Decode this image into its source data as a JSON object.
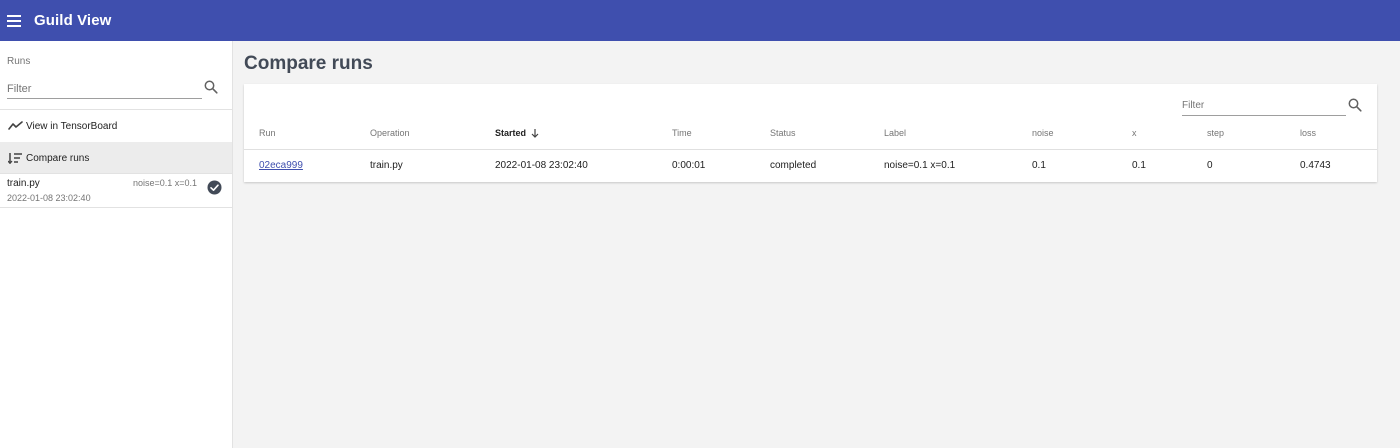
{
  "app": {
    "title": "Guild View"
  },
  "sidebar": {
    "section_title": "Runs",
    "filter_placeholder": "Filter",
    "actions": [
      {
        "label": "View in TensorBoard",
        "icon": "timeline-icon"
      },
      {
        "label": "Compare runs",
        "icon": "sort-list-icon"
      }
    ],
    "runs": [
      {
        "name": "train.py",
        "flags": "noise=0.1  x=0.1",
        "started": "2022-01-08 23:02:40",
        "status": "completed"
      }
    ]
  },
  "main": {
    "title": "Compare runs",
    "filter_placeholder": "Filter",
    "table": {
      "columns": [
        "Run",
        "Operation",
        "Started",
        "Time",
        "Status",
        "Label",
        "noise",
        "x",
        "step",
        "loss"
      ],
      "sorted_column": "Started",
      "rows": [
        [
          "02eca999",
          "train.py",
          "2022-01-08 23:02:40",
          "0:00:01",
          "completed",
          "noise=0.1 x=0.1",
          "0.1",
          "0.1",
          "0",
          "0.4743"
        ]
      ]
    }
  },
  "colors": {
    "appbar": "#3f4fae",
    "link": "#3f4fae",
    "status_completed": "#424a57"
  }
}
